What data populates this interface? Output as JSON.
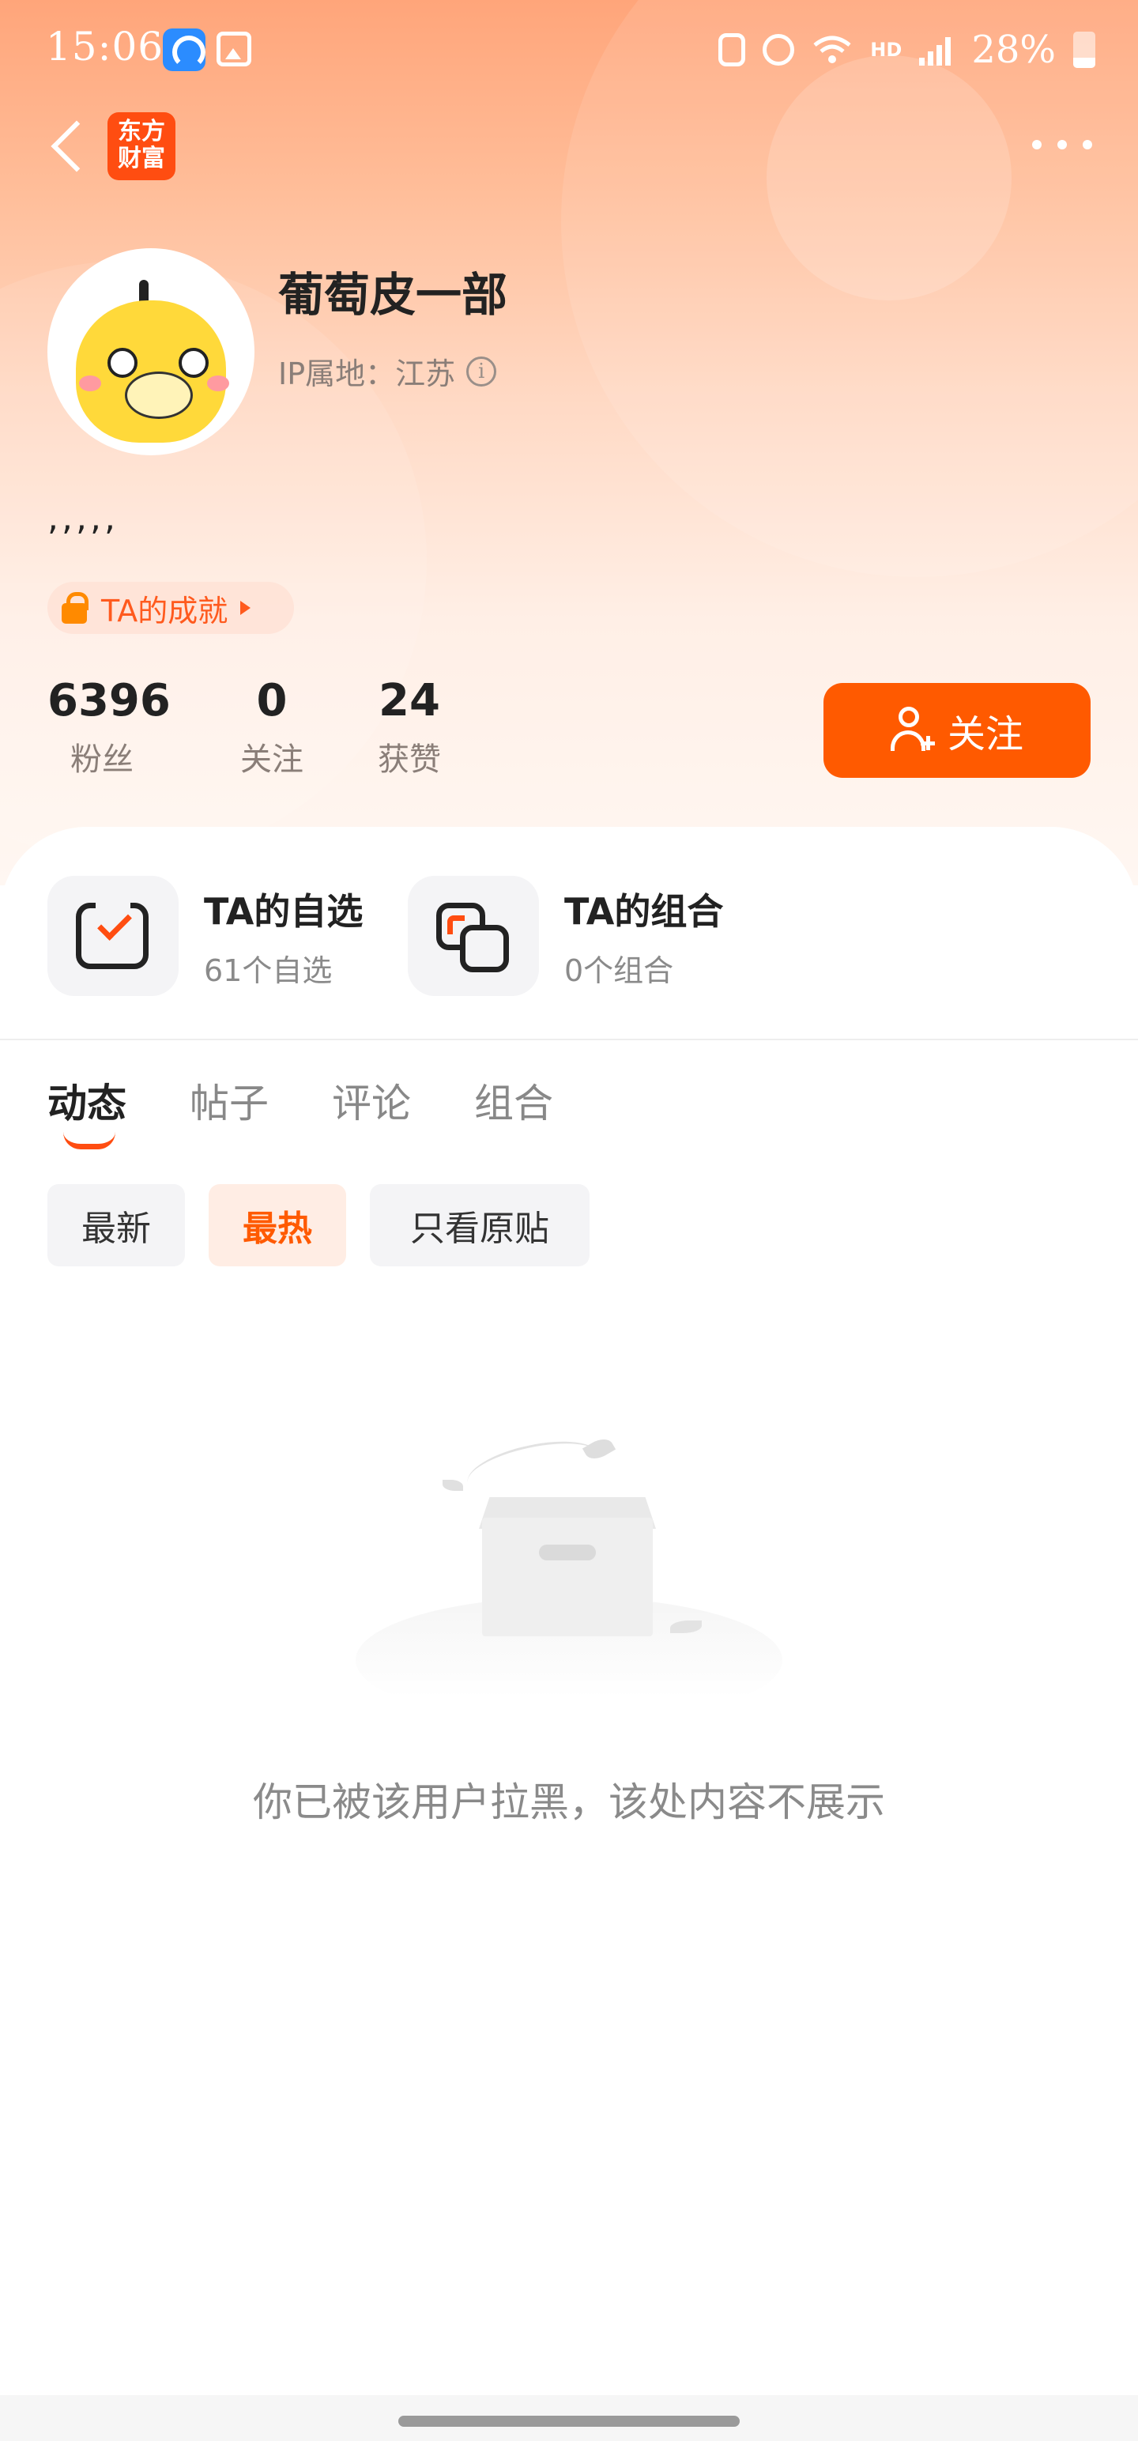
{
  "status_bar": {
    "time": "15:06",
    "battery": "28%",
    "network_label": "HD",
    "icons": [
      "app-notification-icon",
      "gallery-icon",
      "screen-lock-icon",
      "alarm-icon",
      "wifi-icon",
      "signal-icon",
      "battery-icon"
    ]
  },
  "nav": {
    "brand_logo_text": "东方\n财富",
    "back_icon": "chevron-left-icon",
    "more_icon": "more-dots-icon"
  },
  "profile": {
    "username": "葡萄皮一部",
    "ip_location": "IP属地：江苏",
    "bio": ",,,,,",
    "achievement_label": "TA的成就"
  },
  "stats": [
    {
      "value": "6396",
      "label": "粉丝"
    },
    {
      "value": "0",
      "label": "关注"
    },
    {
      "value": "24",
      "label": "获赞"
    }
  ],
  "follow_button": {
    "label": "关注"
  },
  "portfolio": {
    "watchlist": {
      "title": "TA的自选",
      "subtitle": "61个自选"
    },
    "combo": {
      "title": "TA的组合",
      "subtitle": "0个组合"
    }
  },
  "tabs": [
    {
      "label": "动态",
      "active": true
    },
    {
      "label": "帖子",
      "active": false
    },
    {
      "label": "评论",
      "active": false
    },
    {
      "label": "组合",
      "active": false
    }
  ],
  "filters": [
    {
      "label": "最新",
      "active": false
    },
    {
      "label": "最热",
      "active": true
    },
    {
      "label": "只看原贴",
      "active": false
    }
  ],
  "empty_state": {
    "message": "你已被该用户拉黑，该处内容不展示"
  },
  "colors": {
    "accent": "#ff5a00",
    "brand": "#ff4d11",
    "header_gradient_top": "#ffa57a"
  }
}
